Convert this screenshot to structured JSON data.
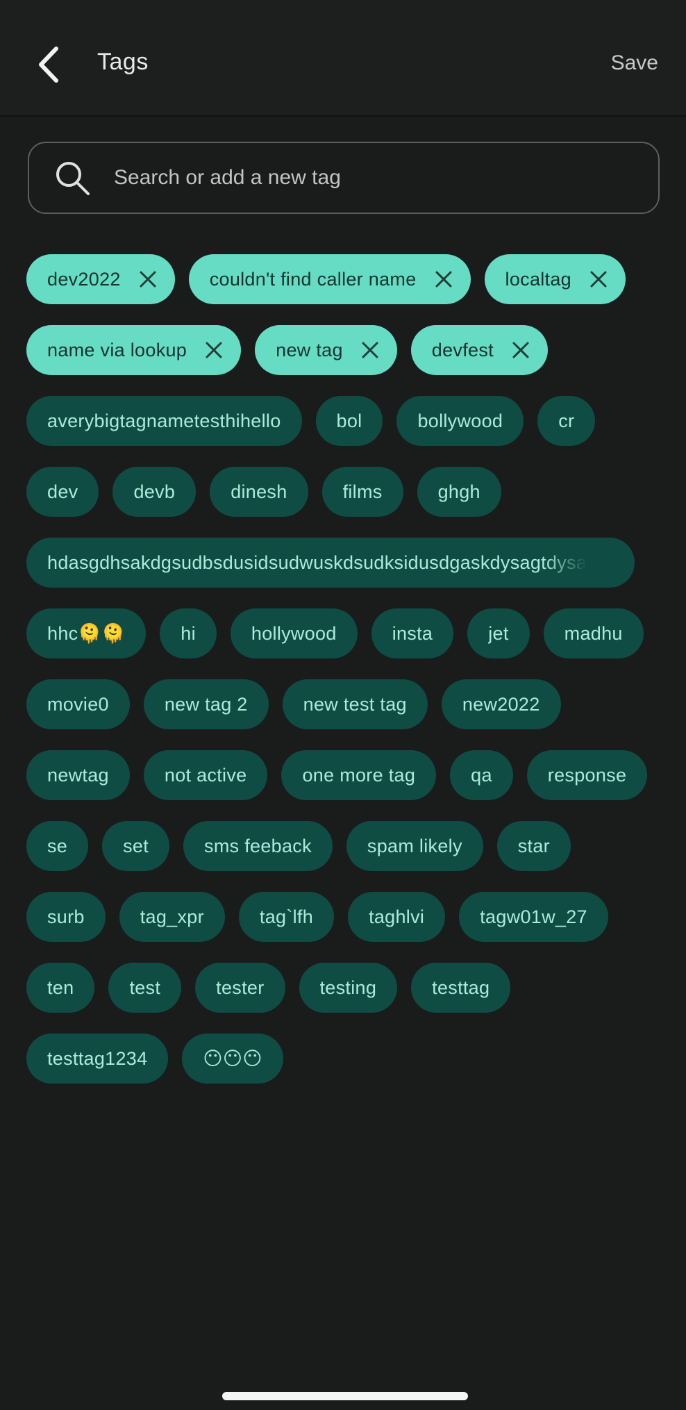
{
  "header": {
    "title": "Tags",
    "save_label": "Save"
  },
  "search": {
    "placeholder": "Search or add a new tag",
    "value": ""
  },
  "selected_tags": [
    "dev2022",
    "couldn't find caller name",
    "localtag",
    "name via lookup",
    "new tag",
    "devfest"
  ],
  "available_tags": [
    "averybigtagnametesthihello",
    "bol",
    "bollywood",
    "cr",
    "dev",
    "devb",
    "dinesh",
    "films",
    "ghgh",
    "hdasgdhsakdgsudbsdusidsudwuskdsudksidusdgaskdysagtdysa",
    "hhc🫠🫠",
    "hi",
    "hollywood",
    "insta",
    "jet",
    "madhu",
    "movie0",
    "new tag 2",
    "new test tag",
    "new2022",
    "newtag",
    "not active",
    "one more tag",
    "qa",
    "response",
    "se",
    "set",
    "sms feeback",
    "spam likely",
    "star",
    "surb",
    "tag_xpr",
    "tag`lfh",
    "taghlvi",
    "tagw01w_27",
    "ten",
    "test",
    "tester",
    "testing",
    "testtag",
    "testtag1234",
    "😶😶😶"
  ],
  "icons": {
    "back": "chevron-left-icon",
    "search": "search-icon",
    "remove": "close-icon"
  },
  "colors": {
    "background": "#1a1c1c",
    "selected_chip": "#66dcc4",
    "selected_chip_text": "#16332c",
    "unselected_chip": "#0f4d44",
    "unselected_chip_text": "#aee9dc"
  }
}
